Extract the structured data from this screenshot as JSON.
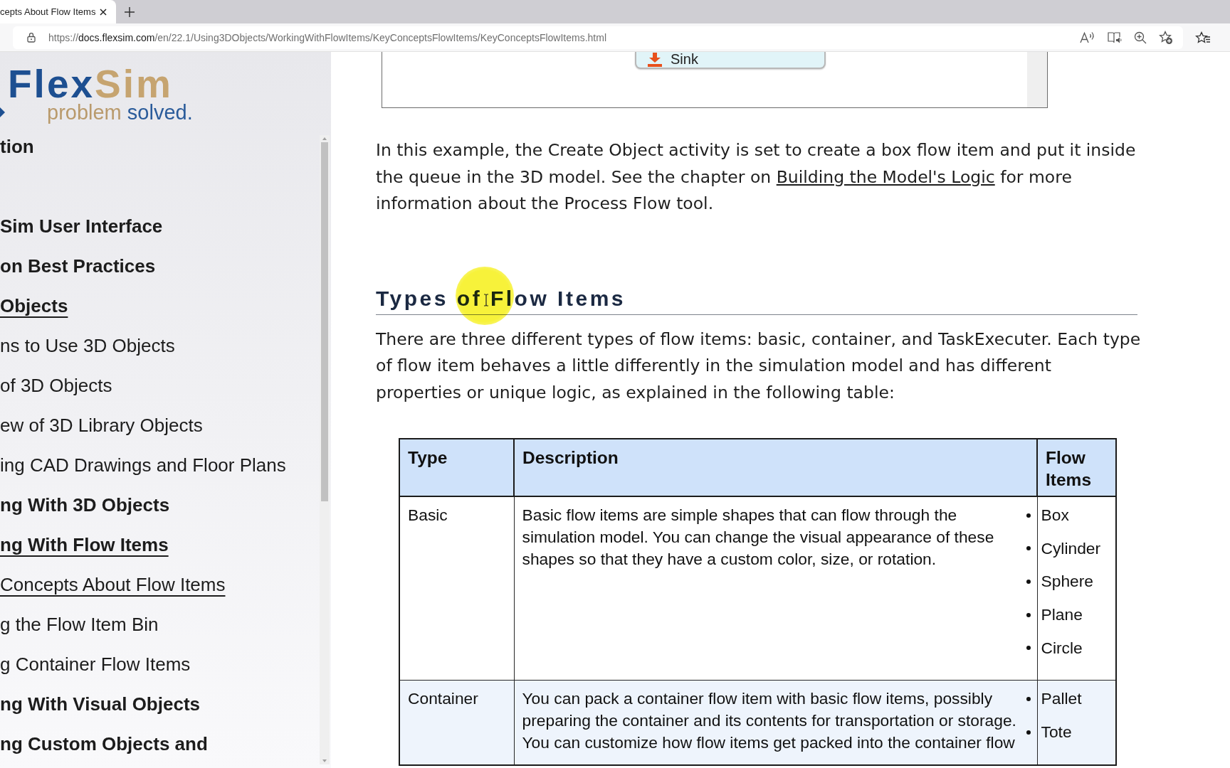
{
  "browser": {
    "tab": {
      "title": "cepts About Flow Items",
      "selected": true
    },
    "url": {
      "scheme": "https://",
      "host": "docs.flexsim.com",
      "path": "/en/22.1/Using3DObjects/WorkingWithFlowItems/KeyConceptsFlowItems/KeyConceptsFlowItems.html"
    }
  },
  "sidebar": {
    "logo": {
      "wordmark": [
        "Flex",
        "Sim"
      ],
      "tagline": [
        "problem",
        "solved."
      ]
    },
    "items": [
      {
        "label": "tion",
        "kind": "section",
        "active": false
      },
      {
        "kind": "clipped"
      },
      {
        "label": "Sim User Interface",
        "kind": "section",
        "active": false
      },
      {
        "label": "on Best Practices",
        "kind": "section",
        "active": false
      },
      {
        "label": "Objects",
        "kind": "section",
        "active": true
      },
      {
        "label": "ns to Use 3D Objects",
        "kind": "page",
        "active": false
      },
      {
        "label": "of 3D Objects",
        "kind": "page",
        "active": false
      },
      {
        "label": "ew of 3D Library Objects",
        "kind": "page",
        "active": false
      },
      {
        "label": "ing CAD Drawings and Floor Plans",
        "kind": "page",
        "active": false
      },
      {
        "label": "ng With 3D Objects",
        "kind": "section",
        "active": false
      },
      {
        "label": "ng With Flow Items",
        "kind": "section",
        "active": true
      },
      {
        "label": "Concepts About Flow Items",
        "kind": "page",
        "active": true
      },
      {
        "label": "g the Flow Item Bin",
        "kind": "page",
        "active": false
      },
      {
        "label": "g Container Flow Items",
        "kind": "page",
        "active": false
      },
      {
        "label": "ng With Visual Objects",
        "kind": "section",
        "active": false
      },
      {
        "label": "ng Custom Objects and",
        "kind": "section",
        "active": false
      }
    ]
  },
  "content": {
    "figure": {
      "node_label": "Sink"
    },
    "intro": {
      "before": "In this example, the Create Object activity is set to create a box flow item and put it inside the queue in the 3D model. See the chapter on",
      "link": "Building the Model's Logic",
      "after": "for more information about the Process Flow tool."
    },
    "heading": "Types of Flow Items",
    "paragraph_lines": [
      "There are three different types of flow items: basic, container, and TaskExecuter. Each type",
      "of flow item behaves a little differently in the simulation model and has different",
      "properties or unique logic, as explained in the following table:"
    ],
    "table": {
      "columns": [
        "Type",
        "Description",
        "Flow Items"
      ],
      "rows": [
        {
          "type": "Basic",
          "description_lines": [
            "Basic flow items are simple shapes that can flow through the",
            "simulation model. You can change the visual appearance of these",
            "shapes so that they have a custom color, size, or rotation."
          ],
          "flow_items": [
            "Box",
            "Cylinder",
            "Sphere",
            "Plane",
            "Circle"
          ]
        },
        {
          "type": "Container",
          "description_lines": [
            "You can pack a container flow item with basic flow items, possibly",
            "preparing the container and its contents for transportation or storage.",
            "You can customize how flow items get packed into the container flow"
          ],
          "flow_items": [
            "Pallet",
            "Tote"
          ]
        }
      ]
    }
  }
}
